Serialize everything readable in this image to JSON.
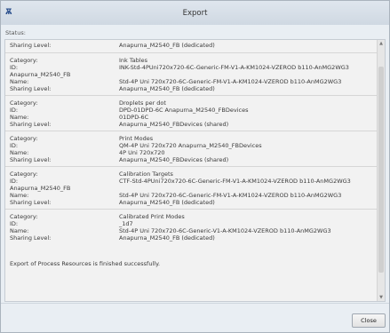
{
  "window": {
    "title": "Export",
    "icon": "app-logo-icon"
  },
  "status": {
    "label": "Status:"
  },
  "log": {
    "sections": [
      {
        "rows": [
          {
            "key": "Sharing Level:",
            "value": "Anapurna_M2540_FB (dedicated)"
          }
        ]
      },
      {
        "rows": [
          {
            "key": "Category:",
            "value": "Ink Tables"
          },
          {
            "key": "ID:",
            "value": "INK-Std-4PUni720x720-6C-Generic-FM-V1-A-KM1024-VZEROD b110-AnMG2WG3"
          },
          {
            "key": "Anapurna_M2540_FB",
            "value": ""
          },
          {
            "key": "Name:",
            "value": "Std-4P Uni 720x720-6C-Generic-FM-V1-A-KM1024-VZEROD b110-AnMG2WG3"
          },
          {
            "key": "Sharing Level:",
            "value": "Anapurna_M2540_FB (dedicated)"
          }
        ]
      },
      {
        "rows": [
          {
            "key": "Category:",
            "value": "Droplets per dot"
          },
          {
            "key": "ID:",
            "value": "DPD-01DPD-6C Anapurna_M2540_FBDevices"
          },
          {
            "key": "Name:",
            "value": "01DPD-6C"
          },
          {
            "key": "Sharing Level:",
            "value": "Anapurna_M2540_FBDevices (shared)"
          }
        ]
      },
      {
        "rows": [
          {
            "key": "Category:",
            "value": "Print Modes"
          },
          {
            "key": "ID:",
            "value": "QM-4P Uni 720x720 Anapurna_M2540_FBDevices"
          },
          {
            "key": "Name:",
            "value": "4P Uni 720x720"
          },
          {
            "key": "Sharing Level:",
            "value": "Anapurna_M2540_FBDevices (shared)"
          }
        ]
      },
      {
        "rows": [
          {
            "key": "Category:",
            "value": "Calibration Targets"
          },
          {
            "key": "ID:",
            "value": "CTF-Std-4PUni720x720-6C-Generic-FM-V1-A-KM1024-VZEROD b110-AnMG2WG3"
          },
          {
            "key": "Anapurna_M2540_FB",
            "value": ""
          },
          {
            "key": "Name:",
            "value": "Std-4P Uni 720x720-6C-Generic-FM-V1-A-KM1024-VZEROD b110-AnMG2WG3"
          },
          {
            "key": "Sharing Level:",
            "value": "Anapurna_M2540_FB (dedicated)"
          }
        ]
      },
      {
        "rows": [
          {
            "key": "Category:",
            "value": "Calibrated Print Modes"
          },
          {
            "key": "ID:",
            "value": "_1d7"
          },
          {
            "key": "Name:",
            "value": "Std-4P Uni 720x720-6C-Generic-V1-A-KM1024-VZEROD b110-AnMG2WG3"
          },
          {
            "key": "Sharing Level:",
            "value": "Anapurna_M2540_FB (dedicated)"
          }
        ]
      }
    ],
    "final_message": "Export of Process Resources is finished successfully."
  },
  "footer": {
    "close_label": "Close"
  }
}
